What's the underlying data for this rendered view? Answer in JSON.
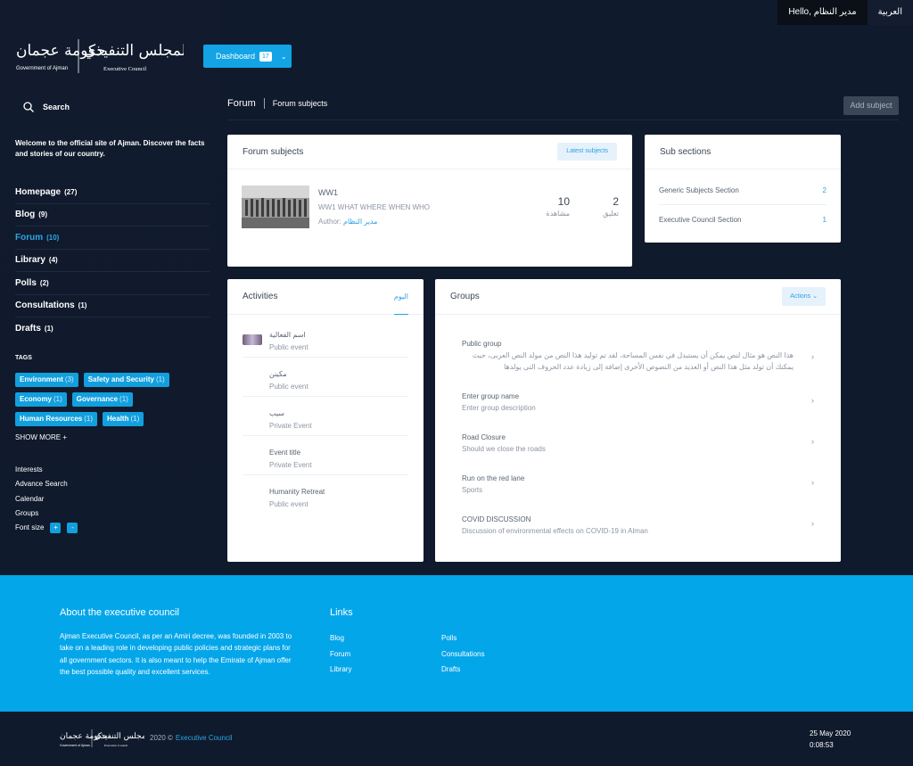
{
  "topbar": {
    "hello": "Hello, مدير النظام",
    "language": "العربية"
  },
  "logo": {
    "arabic_left": "حكومة عجمان",
    "english_left": "Government of Ajman",
    "arabic_right": "المجلس التنفيذي",
    "english_right": "Executive Council"
  },
  "dashboard": {
    "label": "Dashboard",
    "badge": "17"
  },
  "sidebar": {
    "search_label": "Search",
    "welcome": "Welcome to the official site of Ajman. Discover the facts and stories of our country.",
    "nav": [
      {
        "label": "Homepage",
        "count": "(27)"
      },
      {
        "label": "Blog",
        "count": "(9)"
      },
      {
        "label": "Forum",
        "count": "(10)"
      },
      {
        "label": "Library",
        "count": "(4)"
      },
      {
        "label": "Polls",
        "count": "(2)"
      },
      {
        "label": "Consultations",
        "count": "(1)"
      },
      {
        "label": "Drafts",
        "count": "(1)"
      }
    ],
    "tags_title": "TAGS",
    "tags": [
      {
        "label": "Environment",
        "count": "(3)"
      },
      {
        "label": "Safety and Security",
        "count": "(1)"
      },
      {
        "label": "Economy",
        "count": "(1)"
      },
      {
        "label": "Governance",
        "count": "(1)"
      },
      {
        "label": "Human Resources",
        "count": "(1)"
      },
      {
        "label": "Health",
        "count": "(1)"
      }
    ],
    "show_more": "SHOW MORE +",
    "extras": [
      "Interests",
      "Advance Search",
      "Calendar",
      "Groups"
    ],
    "font_size_label": "Font size",
    "font_plus": "+",
    "font_minus": "-"
  },
  "breadcrumb": {
    "section": "Forum",
    "page": "Forum subjects"
  },
  "add_subject": "Add subject",
  "forum_card": {
    "title": "Forum subjects",
    "latest_button": "Latest subjects",
    "topic": {
      "title": "WW1",
      "subtitle": "WW1 WHAT WHERE WHEN WHO",
      "author_label": "Author:",
      "author": "مدير النظام",
      "views": "10",
      "views_label": "مشاهدة",
      "comments": "2",
      "comments_label": "تعليق"
    }
  },
  "sub_sections": {
    "title": "Sub sections",
    "rows": [
      {
        "label": "Generic Subjects Section",
        "count": "2"
      },
      {
        "label": "Executive Council Section",
        "count": "1"
      }
    ]
  },
  "activities": {
    "title": "Activities",
    "tab": "اليوم",
    "items": [
      {
        "title": "اسم الفعالية",
        "type": "Public event"
      },
      {
        "title": "مكينن",
        "type": "Public event"
      },
      {
        "title": "سيب",
        "type": "Private Event"
      },
      {
        "title": "Event title",
        "type": "Private Event"
      },
      {
        "title": "Humanity Retreat",
        "type": "Public event"
      }
    ]
  },
  "groups": {
    "title": "Groups",
    "actions": "Actions",
    "items": [
      {
        "title": "Public group",
        "desc": "هذا النص هو مثال لنص يمكن أن يستبدل في نفس المساحة، لقد تم توليد هذا النص من مولد النص العربى، حيث يمكنك أن تولد مثل هذا النص أو العديد من النصوص الأخرى إضافة إلى زيادة عدد الحروف التى يولدها"
      },
      {
        "title": "Enter group name",
        "desc": "Enter group description"
      },
      {
        "title": "Road Closure",
        "desc": "Should we close the roads"
      },
      {
        "title": "Run on the red lane",
        "desc": "Sports"
      },
      {
        "title": "COVID DISCUSSION",
        "desc": "Discussion of environmental effects on COVID-19 in Alman"
      }
    ]
  },
  "footer": {
    "about_title": "About the executive council",
    "about_text": "Ajman Executive Council, as per an Amiri decree, was founded in 2003 to take on a leading role in developing public policies and strategic plans for all government sectors. It is also meant to help the Emirate of Ajman offer the best possible quality and excellent services.",
    "links_title": "Links",
    "links_col1": [
      "Blog",
      "Forum",
      "Library"
    ],
    "links_col2": [
      "Polls",
      "Consultations",
      "Drafts"
    ],
    "copyright": "2020 ©",
    "copyright_link": "Executive Council",
    "date": "25 May 2020",
    "time": "0:08:53"
  },
  "colors": {
    "accent": "#12a4e4",
    "background": "#0f1a2c",
    "footer_blue": "#04a6ea"
  }
}
